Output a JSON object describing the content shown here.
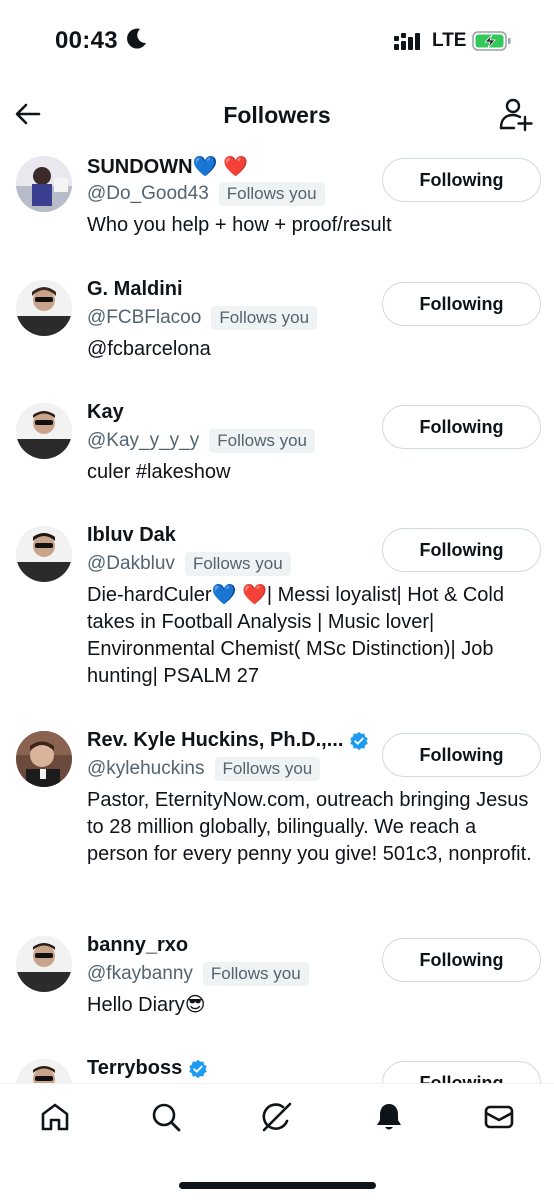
{
  "status_bar": {
    "time": "00:43",
    "network": "LTE"
  },
  "header": {
    "title": "Followers"
  },
  "followers": [
    {
      "name": "SUNDOWN💙 ❤️",
      "handle": "@Do_Good43",
      "follows_you": "Follows you",
      "bio": "Who you help + how + proof/result",
      "button": "Following",
      "verified": false
    },
    {
      "name": "G. Maldini",
      "handle": "@FCBFlacoo",
      "follows_you": "Follows you",
      "bio": "@fcbarcelona",
      "button": "Following",
      "verified": false
    },
    {
      "name": "Kay",
      "handle": "@Kay_y_y_y",
      "follows_you": "Follows you",
      "bio": "culer #lakeshow",
      "button": "Following",
      "verified": false
    },
    {
      "name": "Ibluv Dak",
      "handle": "@Dakbluv",
      "follows_you": "Follows you",
      "bio": "Die-hardCuler💙 ❤️| Messi loyalist| Hot & Cold takes in Football Analysis | Music lover| Environmental Chemist( MSc Distinction)| Job hunting| PSALM 27",
      "button": "Following",
      "verified": false
    },
    {
      "name": "Rev. Kyle Huckins, Ph.D.,...",
      "handle": "@kylehuckins",
      "follows_you": "Follows you",
      "bio": "Pastor, EternityNow.com, outreach bringing Jesus to 28 million globally, bilingually. We reach a person for every penny you give! 501c3, nonprofit.",
      "button": "Following",
      "verified": true
    },
    {
      "name": "banny_rxo",
      "handle": "@fkaybanny",
      "follows_you": "Follows you",
      "bio": "Hello Diary😎",
      "button": "Following",
      "verified": false
    },
    {
      "name": "Terryboss",
      "handle": "",
      "follows_you": "",
      "bio": "",
      "button": "Following",
      "verified": true
    }
  ],
  "nav": [
    "home-icon",
    "search-icon",
    "grok-icon",
    "notifications-icon",
    "messages-icon"
  ],
  "colors": {
    "text": "#0f1419",
    "secondary": "#536471",
    "verified": "#1d9bf0",
    "badge_bg": "#eff3f4",
    "border": "#cfd9de"
  }
}
